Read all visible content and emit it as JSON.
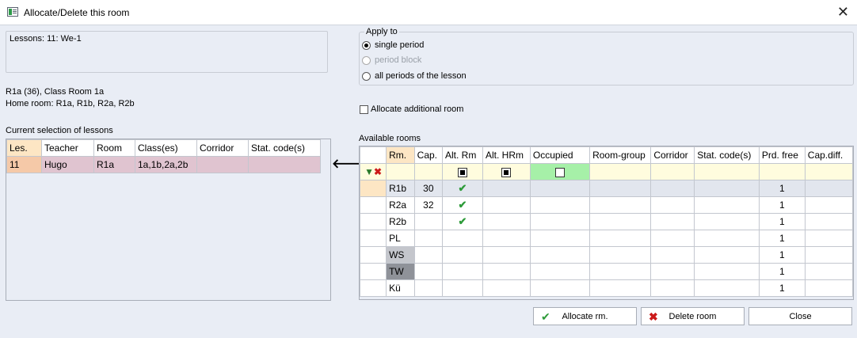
{
  "window": {
    "title": "Allocate/Delete this room"
  },
  "lessons_box": {
    "text": "Lessons: 11: We-1"
  },
  "info": {
    "room_line": "R1a (36), Class Room 1a",
    "home_room_line": "Home room: R1a, R1b, R2a, R2b"
  },
  "current_selection": {
    "label": "Current selection of lessons",
    "columns": [
      "Les.",
      "Teacher",
      "Room",
      "Class(es)",
      "Corridor",
      "Stat. code(s)"
    ],
    "rows": [
      {
        "les": "11",
        "teacher": "Hugo",
        "room": "R1a",
        "classes": "1a,1b,2a,2b",
        "corridor": "",
        "stat": ""
      }
    ]
  },
  "apply_to": {
    "legend": "Apply to",
    "options": [
      {
        "label": "single period",
        "selected": true,
        "enabled": true
      },
      {
        "label": "period block",
        "selected": false,
        "enabled": false
      },
      {
        "label": "all periods of the lesson",
        "selected": false,
        "enabled": true
      }
    ]
  },
  "additional_room": {
    "label": "Allocate additional room",
    "checked": false
  },
  "available_rooms": {
    "label": "Available rooms",
    "columns": [
      "Rm.",
      "Cap.",
      "Alt. Rm",
      "Alt. HRm",
      "Occupied",
      "Room-group",
      "Corridor",
      "Stat. code(s)",
      "Prd. free",
      "Cap.diff."
    ],
    "rows": [
      {
        "rm": "R1b",
        "cap": "30",
        "alt_rm": true,
        "prd_free": "1",
        "current": true
      },
      {
        "rm": "R2a",
        "cap": "32",
        "alt_rm": true,
        "prd_free": "1"
      },
      {
        "rm": "R2b",
        "cap": "",
        "alt_rm": true,
        "prd_free": "1"
      },
      {
        "rm": "PL",
        "cap": "",
        "alt_rm": false,
        "prd_free": "1"
      },
      {
        "rm": "WS",
        "cap": "",
        "alt_rm": false,
        "prd_free": "1",
        "shade": "ws"
      },
      {
        "rm": "TW",
        "cap": "",
        "alt_rm": false,
        "prd_free": "1",
        "shade": "tw"
      },
      {
        "rm": "Kü",
        "cap": "",
        "alt_rm": false,
        "prd_free": "1"
      }
    ]
  },
  "buttons": {
    "allocate": "Allocate rm.",
    "delete": "Delete room",
    "close": "Close"
  },
  "colors": {
    "background": "#e9edf5",
    "selected_row": "#e0c4d0",
    "header_highlight": "#fde6c4",
    "filter_row": "#fffcde",
    "occupied_filter": "#a6f0a8",
    "check_green": "#2e9b3a",
    "delete_red": "#cc1a1a"
  },
  "icons": {
    "window": "window-app-icon",
    "close": "close-icon",
    "arrow": "left-arrow-icon",
    "filter": "funnel-icon",
    "clear_filter": "x-icon",
    "allocate": "checkmark-icon",
    "delete": "red-x-icon"
  }
}
